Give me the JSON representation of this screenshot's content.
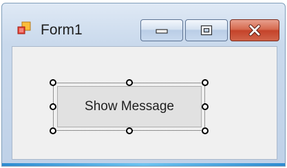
{
  "window": {
    "title": "Form1",
    "icon": "winforms-form-icon",
    "caption_buttons": {
      "minimize": "minimize-icon",
      "maximize": "maximize-icon",
      "close": "close-icon"
    },
    "colors": {
      "close_button": "#c4432a",
      "frame": "#c9d9ec",
      "client_background": "#f0f0f0"
    }
  },
  "form": {
    "button_label": "Show Message",
    "button_selected": true
  }
}
